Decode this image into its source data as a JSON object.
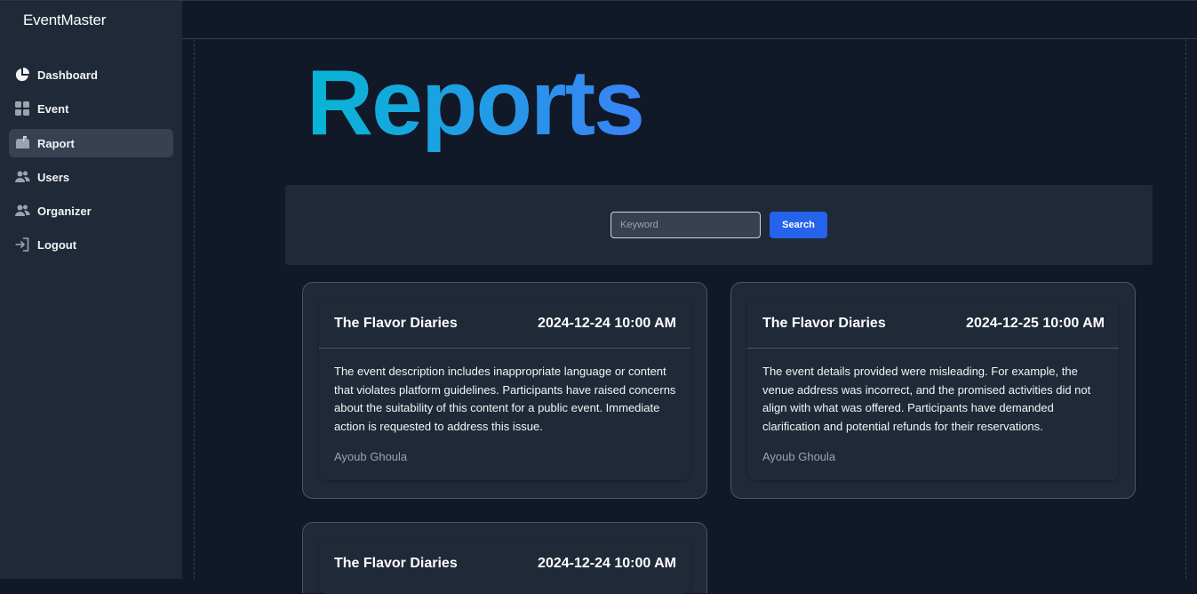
{
  "app": {
    "brand": "EventMaster"
  },
  "sidebar": {
    "items": [
      {
        "label": "Dashboard",
        "icon": "pie-chart-icon",
        "active": false
      },
      {
        "label": "Event",
        "icon": "grid-icon",
        "active": false
      },
      {
        "label": "Raport",
        "icon": "mailbox-icon",
        "active": true
      },
      {
        "label": "Users",
        "icon": "users-icon",
        "active": false
      },
      {
        "label": "Organizer",
        "icon": "users-icon",
        "active": false
      },
      {
        "label": "Logout",
        "icon": "logout-icon",
        "active": false
      }
    ]
  },
  "main": {
    "title": "Reports",
    "search": {
      "placeholder": "Keyword",
      "value": "",
      "button_label": "Search"
    },
    "reports": [
      {
        "event": "The Flavor Diaries",
        "datetime": "2024-12-24 10:00 AM",
        "description": "The event description includes inappropriate language or content that violates platform guidelines. Participants have raised concerns about the suitability of this content for a public event. Immediate action is requested to address this issue.",
        "author": "Ayoub Ghoula"
      },
      {
        "event": "The Flavor Diaries",
        "datetime": "2024-12-25 10:00 AM",
        "description": "The event details provided were misleading. For example, the venue address was incorrect, and the promised activities did not align with what was offered. Participants have demanded clarification and potential refunds for their reservations.",
        "author": "Ayoub Ghoula"
      },
      {
        "event": "The Flavor Diaries",
        "datetime": "2024-12-24 10:00 AM",
        "description": "",
        "author": ""
      }
    ]
  },
  "colors": {
    "background": "#111827",
    "panel": "#1f2937",
    "accent": "#2563eb",
    "title_gradient_start": "#06b6d4",
    "title_gradient_end": "#3b82f6"
  }
}
